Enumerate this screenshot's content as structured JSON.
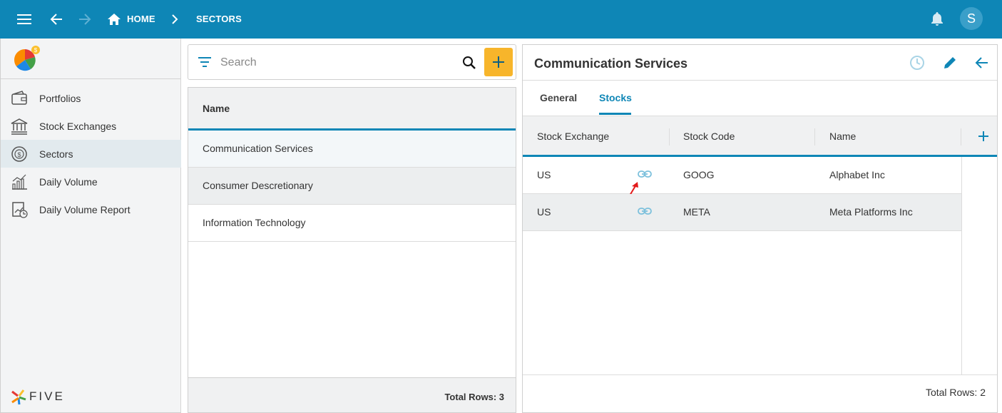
{
  "topbar": {
    "home_label": "HOME",
    "sectors_label": "SECTORS",
    "avatar_initial": "S",
    "bg_color": "#0e86b6"
  },
  "sidebar": {
    "items": [
      {
        "label": "Portfolios",
        "icon": "wallet-icon"
      },
      {
        "label": "Stock Exchanges",
        "icon": "bank-icon"
      },
      {
        "label": "Sectors",
        "icon": "dollar-cycle-icon",
        "active": true
      },
      {
        "label": "Daily Volume",
        "icon": "bar-chart-icon"
      },
      {
        "label": "Daily Volume Report",
        "icon": "report-chart-icon"
      }
    ],
    "brand": "FIVE"
  },
  "search": {
    "placeholder": "Search"
  },
  "list": {
    "header": "Name",
    "rows": [
      "Communication Services",
      "Consumer Descretionary",
      "Information Technology"
    ],
    "total_rows": "Total Rows: 3"
  },
  "detail": {
    "title": "Communication Services",
    "tabs": [
      {
        "label": "General",
        "active": false
      },
      {
        "label": "Stocks",
        "active": true
      }
    ],
    "columns": [
      "Stock Exchange",
      "Stock Code",
      "Name"
    ],
    "rows": [
      {
        "exchange": "US",
        "code": "GOOG",
        "name": "Alphabet Inc"
      },
      {
        "exchange": "US",
        "code": "META",
        "name": "Meta Platforms Inc"
      }
    ],
    "total_rows": "Total Rows: 2"
  },
  "colors": {
    "accent": "#0e86b6",
    "add_button": "#f7b52b"
  }
}
